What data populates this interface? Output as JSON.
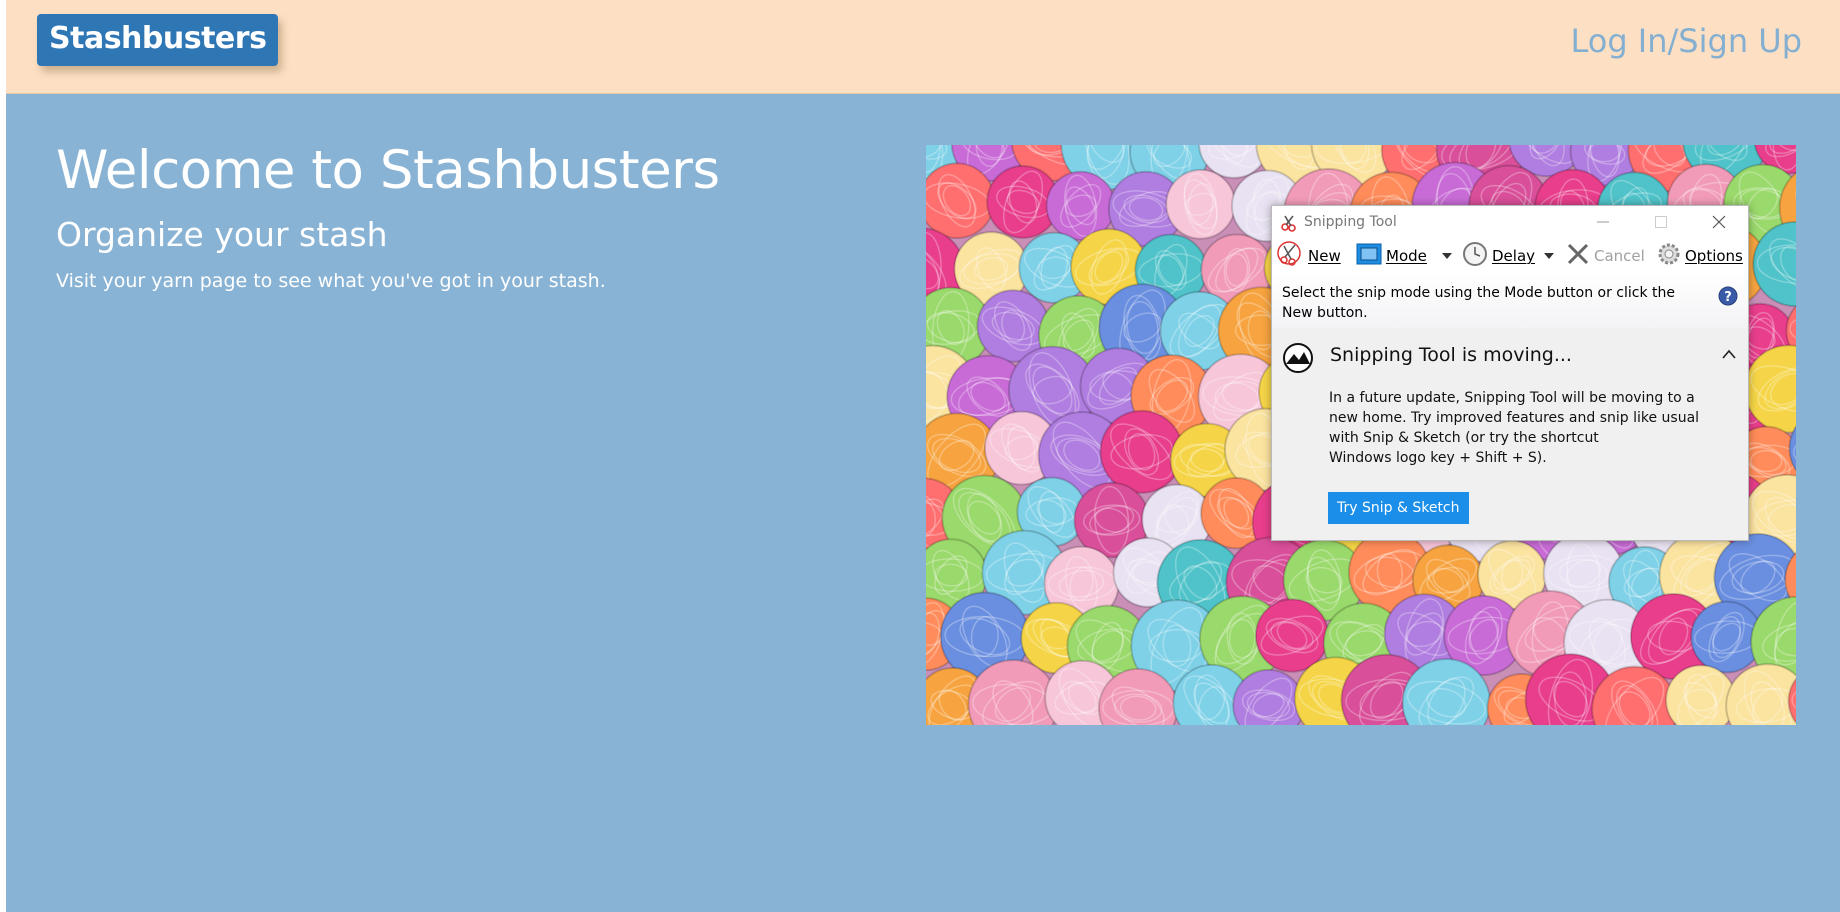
{
  "navbar": {
    "brand": "Stashbusters",
    "login": "Log In/Sign Up"
  },
  "hero": {
    "title": "Welcome to Stashbusters",
    "subtitle": "Organize your stash",
    "text": "Visit your yarn page to see what you've got in your stash."
  },
  "hero_image": {
    "icon": "yarn-balls-photo"
  },
  "snipping_tool": {
    "title": "Snipping Tool",
    "toolbar": {
      "new_label": "New",
      "mode_label": "Mode",
      "delay_label": "Delay",
      "cancel_label": "Cancel",
      "options_label": "Options"
    },
    "hint": "Select the snip mode using the Mode button or click the New button.",
    "panel": {
      "title": "Snipping Tool is moving...",
      "line1": "In a future update, Snipping Tool will be moving to a",
      "line2": "new home. Try improved features and snip like usual",
      "line3": "with Snip & Sketch (or try the shortcut",
      "line4": "Windows logo key + Shift + S).",
      "button": "Try Snip & Sketch"
    }
  },
  "colors": {
    "page_bg": "#89b3d4",
    "navbar_bg": "#fde0c4",
    "brand_bg": "#2f76b4",
    "login_text": "#84afd1",
    "snip_button": "#1a8ee8"
  }
}
